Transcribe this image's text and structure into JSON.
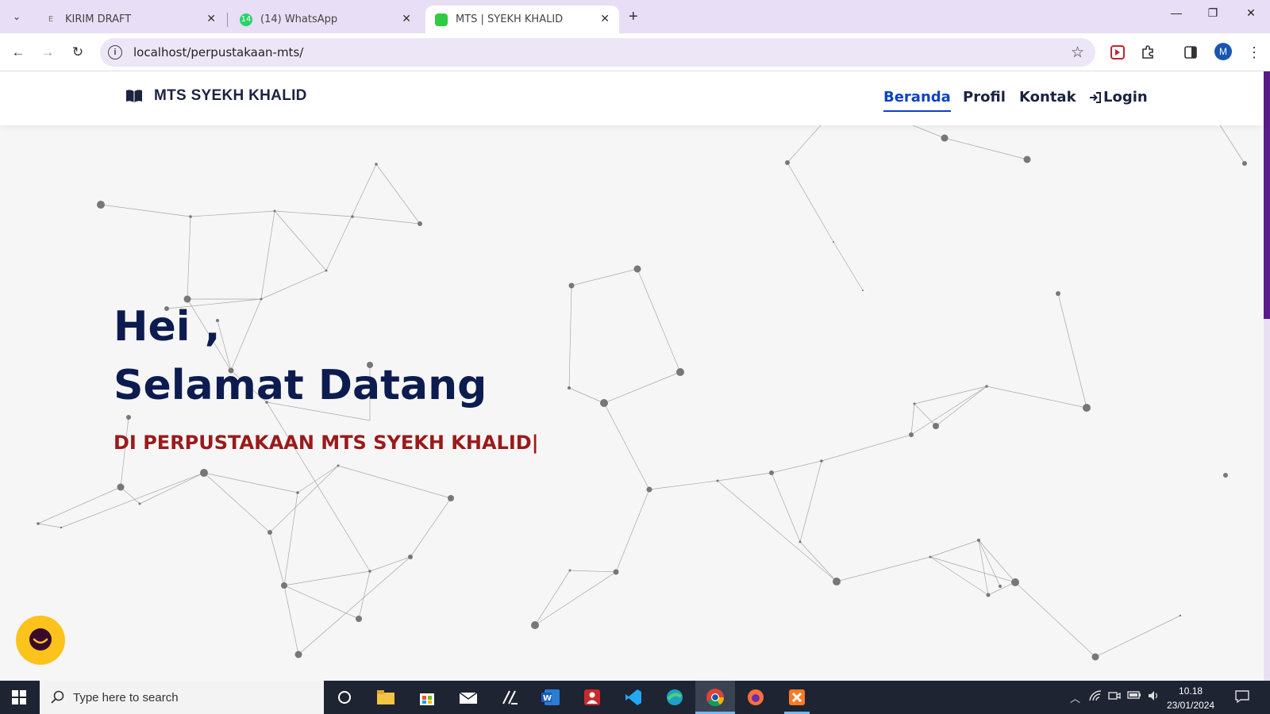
{
  "browser": {
    "tabs": [
      {
        "title": "KIRIM DRAFT",
        "active": false
      },
      {
        "title": "(14) WhatsApp",
        "active": false,
        "badge": "14"
      },
      {
        "title": "MTS | SYEKH KHALID",
        "active": true
      }
    ],
    "url": "localhost/perpustakaan-mts/",
    "profile_initial": "M"
  },
  "site": {
    "brand": "MTS SYEKH KHALID",
    "nav": [
      {
        "label": "Beranda",
        "active": true
      },
      {
        "label": "Profil"
      },
      {
        "label": "Kontak"
      },
      {
        "label": "Login"
      }
    ],
    "hero": {
      "line1": "Hei ,",
      "line2": "Selamat Datang",
      "subtitle": "DI PERPUSTAKAAN MTS SYEKH KHALID|"
    }
  },
  "taskbar": {
    "search_placeholder": "Type here to search",
    "time": "10.18",
    "date": "23/01/2024"
  },
  "colors": {
    "brand_dark": "#0d1c4f",
    "nav_active": "#0d41c9",
    "subtitle_red": "#9a1a1a",
    "chat_button": "#fcc31c"
  }
}
